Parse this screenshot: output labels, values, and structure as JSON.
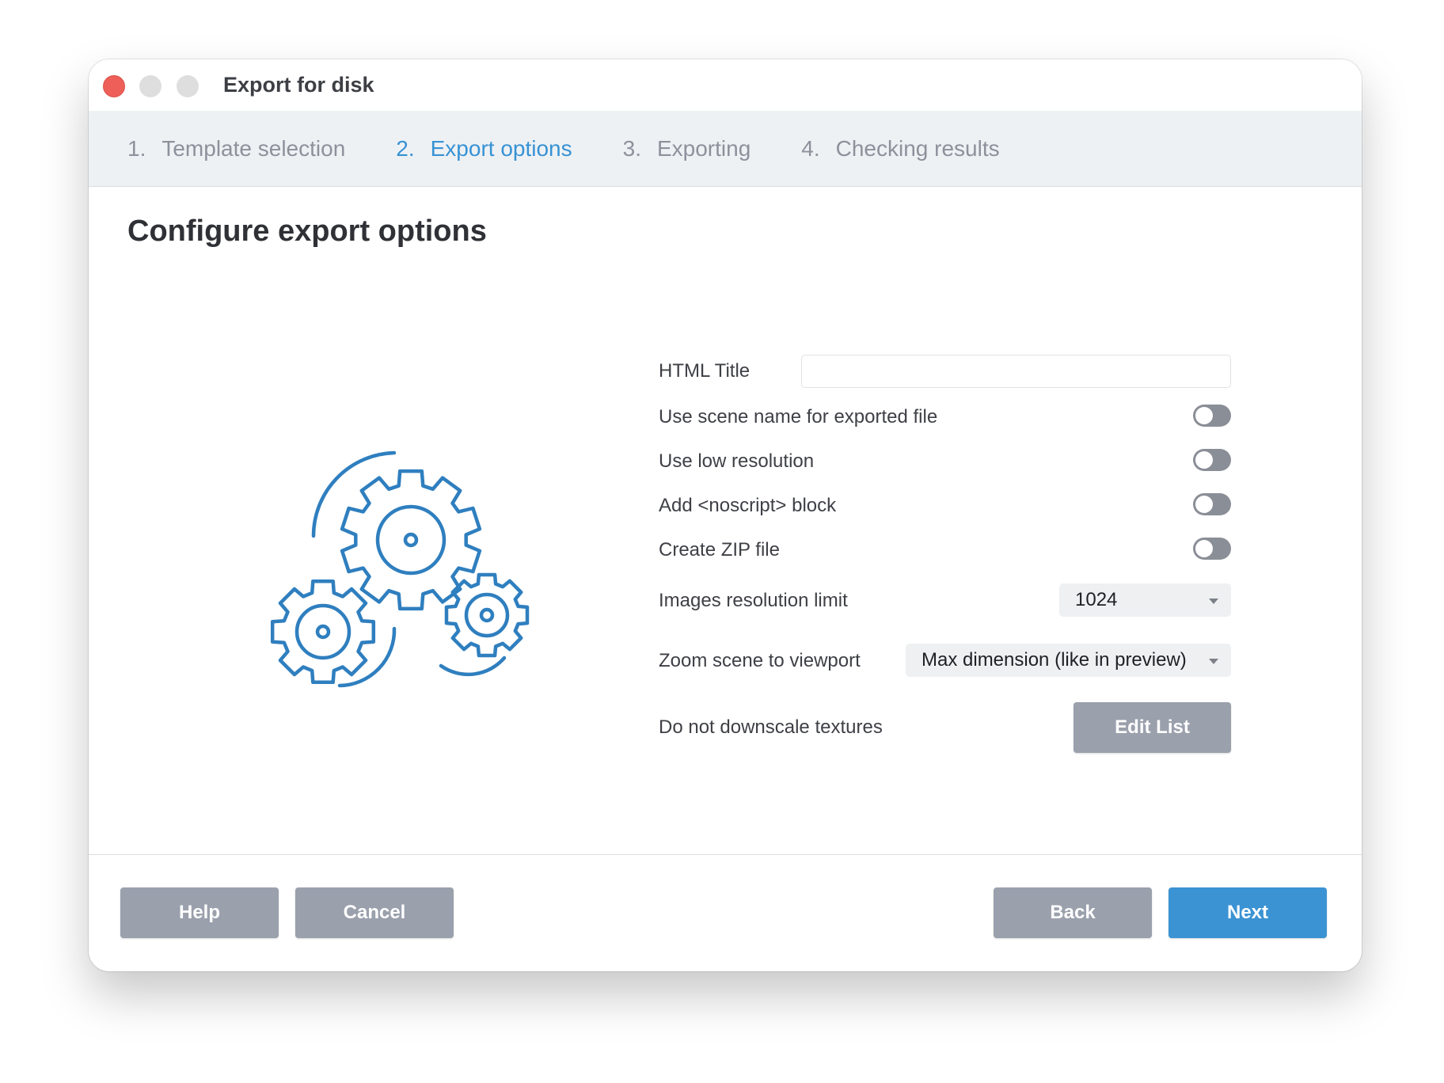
{
  "window": {
    "title": "Export for disk"
  },
  "steps": [
    {
      "num": "1.",
      "label": "Template selection",
      "active": false
    },
    {
      "num": "2.",
      "label": "Export options",
      "active": true
    },
    {
      "num": "3.",
      "label": "Exporting",
      "active": false
    },
    {
      "num": "4.",
      "label": "Checking results",
      "active": false
    }
  ],
  "page": {
    "title": "Configure export options"
  },
  "illustration": {
    "icon": "gears-icon",
    "color": "#2f7fbf"
  },
  "form": {
    "html_title": {
      "label": "HTML Title",
      "value": ""
    },
    "use_scene_name": {
      "label": "Use scene name for exported file",
      "on": false
    },
    "use_low_resolution": {
      "label": "Use low resolution",
      "on": false
    },
    "add_noscript": {
      "label": "Add <noscript> block",
      "on": false
    },
    "create_zip": {
      "label": "Create ZIP file",
      "on": false
    },
    "images_resolution_limit": {
      "label": "Images resolution limit",
      "value": "1024"
    },
    "zoom_scene": {
      "label": "Zoom scene to viewport",
      "value": "Max dimension (like in preview)"
    },
    "do_not_downscale": {
      "label": "Do not downscale textures",
      "button": "Edit List"
    }
  },
  "footer": {
    "help": "Help",
    "cancel": "Cancel",
    "back": "Back",
    "next": "Next"
  },
  "colors": {
    "accent": "#3b93d3",
    "button_gray": "#9aa0ac",
    "toggle_off": "#8a8e96"
  }
}
